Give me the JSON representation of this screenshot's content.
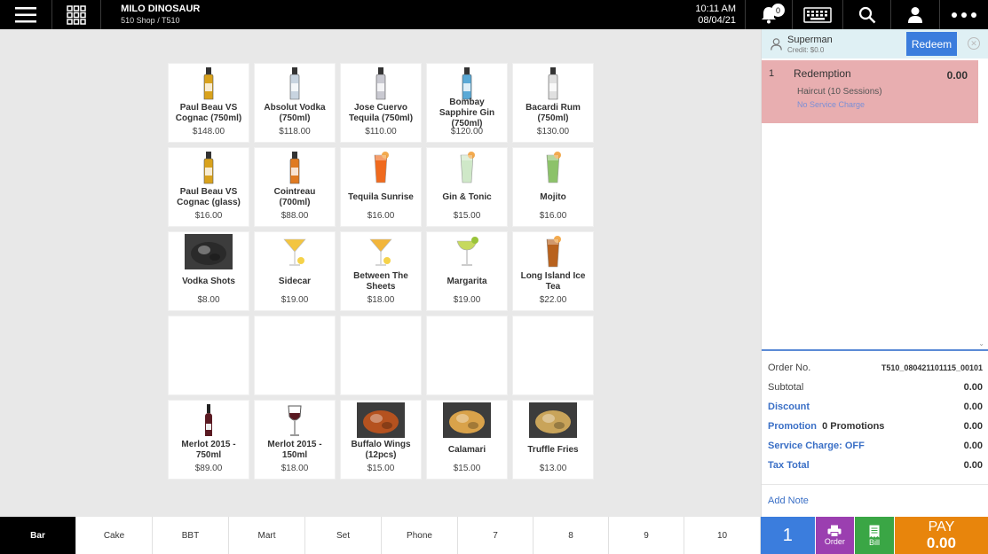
{
  "header": {
    "store_name": "MILO DINOSAUR",
    "store_sub": "510 Shop / T510",
    "time": "10:11 AM",
    "date": "08/04/21",
    "notification_count": "0"
  },
  "products": [
    {
      "name": "Paul Beau VS Cognac (750ml)",
      "price": "$148.00",
      "icon": "bottle-icon",
      "color": "#d9a21c"
    },
    {
      "name": "Absolut Vodka (750ml)",
      "price": "$118.00",
      "icon": "bottle-icon",
      "color": "#c8d4e0"
    },
    {
      "name": "Jose Cuervo Tequila (750ml)",
      "price": "$110.00",
      "icon": "bottle-icon",
      "color": "#c9c9d1"
    },
    {
      "name": "Bombay Sapphire Gin (750ml)",
      "price": "$120.00",
      "icon": "bottle-icon",
      "color": "#5aa9d6"
    },
    {
      "name": "Bacardi Rum (750ml)",
      "price": "$130.00",
      "icon": "bottle-icon",
      "color": "#e0e0e0"
    },
    {
      "name": "Paul Beau VS Cognac (glass)",
      "price": "$16.00",
      "icon": "bottle-icon",
      "color": "#d9a21c"
    },
    {
      "name": "Cointreau (700ml)",
      "price": "$88.00",
      "icon": "bottle-icon",
      "color": "#e07b22"
    },
    {
      "name": "Tequila Sunrise",
      "price": "$16.00",
      "icon": "cocktail-glass-icon",
      "color": "#f06a1e"
    },
    {
      "name": "Gin & Tonic",
      "price": "$15.00",
      "icon": "cocktail-glass-icon",
      "color": "#cfe8c8"
    },
    {
      "name": "Mojito",
      "price": "$16.00",
      "icon": "cocktail-glass-icon",
      "color": "#8cc26a"
    },
    {
      "name": "Vodka Shots",
      "price": "$8.00",
      "icon": "photo-icon",
      "color": "#2a2a2a"
    },
    {
      "name": "Sidecar",
      "price": "$19.00",
      "icon": "martini-glass-icon",
      "color": "#f3c540"
    },
    {
      "name": "Between The Sheets",
      "price": "$18.00",
      "icon": "martini-glass-icon",
      "color": "#f2b53a"
    },
    {
      "name": "Margarita",
      "price": "$19.00",
      "icon": "margarita-glass-icon",
      "color": "#c6d95e"
    },
    {
      "name": "Long Island Ice Tea",
      "price": "$22.00",
      "icon": "cocktail-glass-icon",
      "color": "#b8621e"
    },
    {
      "name": "",
      "price": "",
      "icon": "",
      "color": ""
    },
    {
      "name": "",
      "price": "",
      "icon": "",
      "color": ""
    },
    {
      "name": "",
      "price": "",
      "icon": "",
      "color": ""
    },
    {
      "name": "",
      "price": "",
      "icon": "",
      "color": ""
    },
    {
      "name": "",
      "price": "",
      "icon": "",
      "color": ""
    },
    {
      "name": "Merlot 2015 - 750ml",
      "price": "$89.00",
      "icon": "wine-bottle-icon",
      "color": "#5a1a22"
    },
    {
      "name": "Merlot 2015 - 150ml",
      "price": "$18.00",
      "icon": "wine-glass-icon",
      "color": "#5a1a22"
    },
    {
      "name": "Buffalo Wings (12pcs)",
      "price": "$15.00",
      "icon": "photo-icon",
      "color": "#b5521f"
    },
    {
      "name": "Calamari",
      "price": "$15.00",
      "icon": "photo-icon",
      "color": "#d9a24a"
    },
    {
      "name": "Truffle Fries",
      "price": "$13.00",
      "icon": "photo-icon",
      "color": "#c9a45a"
    }
  ],
  "customer": {
    "name": "Superman",
    "credit": "Credit: $0.0",
    "redeem_label": "Redeem"
  },
  "order_line": {
    "qty": "1",
    "title": "Redemption",
    "amount": "0.00",
    "modifier": "Haircut (10 Sessions)",
    "service_charge": "No Service Charge"
  },
  "summary": {
    "order_no_label": "Order No.",
    "order_no": "T510_080421101115_00101",
    "subtotal_label": "Subtotal",
    "subtotal": "0.00",
    "discount_label": "Discount",
    "discount": "0.00",
    "promotion_label": "Promotion",
    "promotion_count": "0 Promotions",
    "promotion": "0.00",
    "service_label": "Service Charge: OFF",
    "service": "0.00",
    "tax_label": "Tax Total",
    "tax": "0.00",
    "add_note": "Add Note"
  },
  "categories": [
    "Bar",
    "Cake",
    "BBT",
    "Mart",
    "Set",
    "Phone",
    "7",
    "8",
    "9",
    "10"
  ],
  "actions": {
    "qty": "1",
    "order_label": "Order",
    "bill_label": "Bill",
    "pay_label": "PAY",
    "pay_amount": "0.00"
  },
  "colors": {
    "accent_blue": "#3b7ddd",
    "order_purple": "#9b3fb0",
    "bill_green": "#3aa645",
    "pay_orange": "#e8850c",
    "line_pink": "#e8aeb0"
  }
}
